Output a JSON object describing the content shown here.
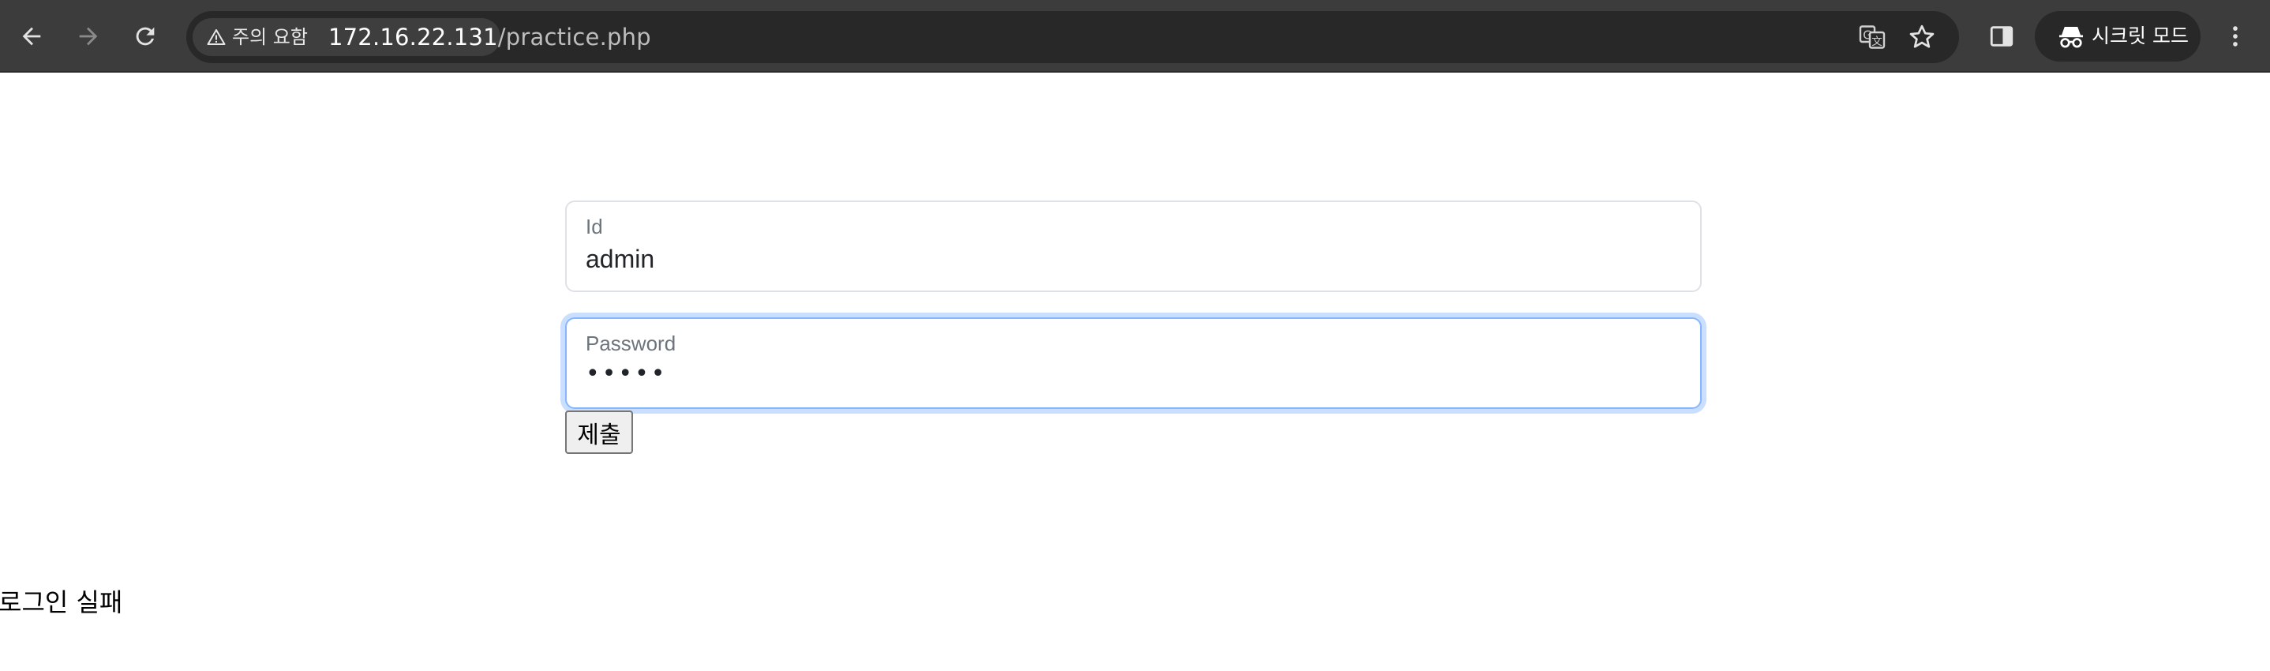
{
  "browser": {
    "security_chip_label": "주의 요함",
    "url_host": "172.16.22.131",
    "url_path": "/practice.php",
    "incognito_label": "시크릿 모드",
    "icons": [
      "back-arrow-icon",
      "forward-arrow-icon",
      "reload-icon",
      "warning-icon",
      "translate-icon",
      "bookmark-star-icon",
      "side-panel-icon",
      "incognito-icon",
      "more-menu-icon"
    ]
  },
  "form": {
    "id_label": "Id",
    "id_value": "admin",
    "password_label": "Password",
    "password_masked": "•••••",
    "submit_label": "제출"
  },
  "result_message": "로그인 실패",
  "colors": {
    "toolbar_bg": "#3c3c3c",
    "omnibox_bg": "#282828",
    "focus_border": "#86b7fe"
  }
}
